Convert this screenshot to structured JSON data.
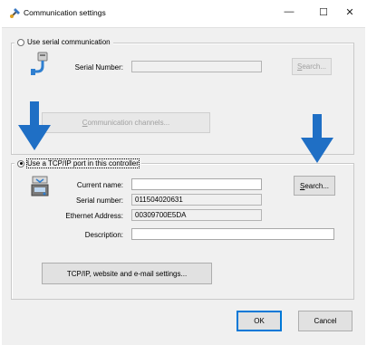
{
  "window": {
    "title": "Communication settings",
    "controls": {
      "minimize": "—",
      "maximize": "☐",
      "close": "✕"
    }
  },
  "serial_group": {
    "radio_label": "Use serial communication",
    "selected": false,
    "serial_number_label": "Serial Number:",
    "serial_number_value": "",
    "search_prefix": "",
    "search_accel": "S",
    "search_rest": "earch...",
    "channels_prefix": "",
    "channels_accel": "C",
    "channels_rest": "ommunication channels..."
  },
  "tcp_group": {
    "radio_label": "Use a TCP/IP port in this controller",
    "selected": true,
    "current_name_label": "Current name:",
    "current_name_value": "",
    "serial_number_label": "Serial number:",
    "serial_number_value": "011504020631",
    "ethernet_label": "Ethernet Address:",
    "ethernet_value": "00309700E5DA",
    "description_label": "Description:",
    "description_value": "",
    "search_prefix": "",
    "search_accel": "S",
    "search_rest": "earch...",
    "settings_label": "TCP/IP, website and e-mail settings..."
  },
  "footer": {
    "ok_label": "OK",
    "cancel_label": "Cancel"
  },
  "colors": {
    "annotation_arrow": "#1f6fc5",
    "focus_border": "#0078d7"
  }
}
